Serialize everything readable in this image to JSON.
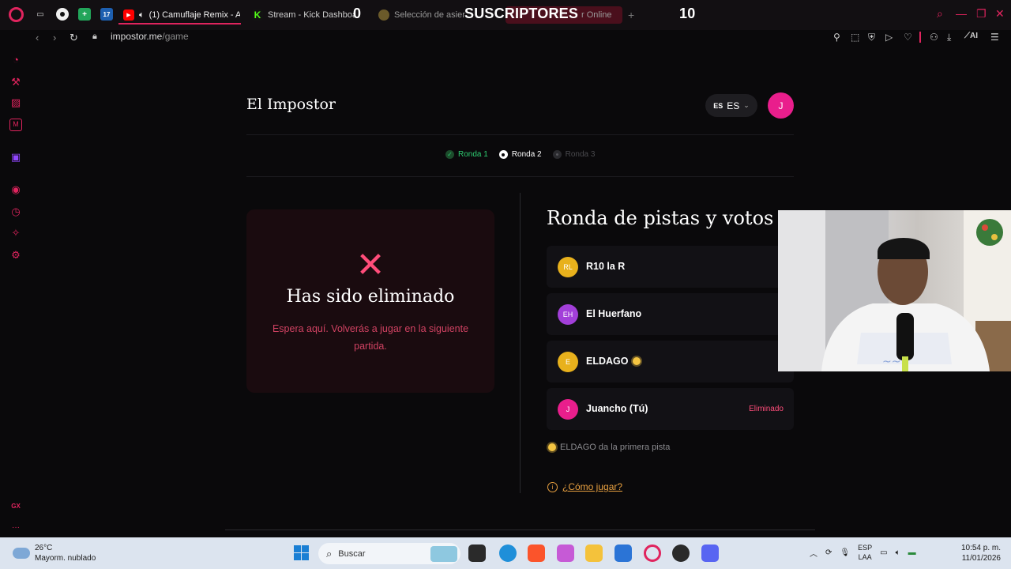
{
  "browser": {
    "tabs": [
      {
        "label": "(1) Camuflaje Remix - A",
        "icon": "youtube-icon"
      },
      {
        "label": "Stream - Kick Dashboar",
        "icon": "kick-icon"
      },
      {
        "label": "Selección de asient",
        "icon": "seat-icon"
      },
      {
        "label": "r Online",
        "icon": "game-icon"
      }
    ],
    "new_tab": "+",
    "url_host": "impostor.me",
    "url_path": "/game",
    "tools": [
      "pin-icon",
      "snapshot-icon",
      "shield-icon",
      "play-icon",
      "heart-icon",
      "profile-icon",
      "download-icon",
      "AI",
      "menu-icon"
    ],
    "ai_label": "AI"
  },
  "stream_overlay": {
    "subscribers_count": "0",
    "subscribers_label": "SUSCRIPTORES",
    "subscribers_goal": "10"
  },
  "sidebar": {
    "items": [
      "speed-dial-icon",
      "briefcase-icon",
      "gx-corner-icon",
      "messenger-icon",
      "twitch-icon",
      "player-icon",
      "history-icon",
      "extensions-icon",
      "settings-icon"
    ],
    "footer_label": "GX",
    "more": "···"
  },
  "header": {
    "title": "El Impostor",
    "lang_flag": "ES",
    "lang_code": "ES",
    "avatar_initial": "J"
  },
  "rounds": [
    {
      "label": "Ronda 1",
      "state": "done"
    },
    {
      "label": "Ronda 2",
      "state": "active"
    },
    {
      "label": "Ronda 3",
      "state": "pending"
    }
  ],
  "eliminated": {
    "icon": "✕",
    "title": "Has sido eliminado",
    "message": "Espera aquí. Volverás a jugar en la siguiente partida."
  },
  "voting": {
    "title": "Ronda de pistas y votos",
    "players": [
      {
        "initials": "RL",
        "name": "R10 la R",
        "color": "#e8b11c",
        "status": "",
        "first_clue": false
      },
      {
        "initials": "EH",
        "name": "El Huerfano",
        "color": "#a23fd9",
        "status": "",
        "first_clue": false
      },
      {
        "initials": "E",
        "name": "ELDAGO",
        "color": "#e8b11c",
        "status": "",
        "first_clue": true
      },
      {
        "initials": "J",
        "name": "Juancho (Tú)",
        "color": "#e91e8c",
        "status": "Eliminado",
        "first_clue": false
      }
    ],
    "first_clue_text": "ELDAGO da la primera pista",
    "how_to_play": "¿Cómo jugar?"
  },
  "taskbar": {
    "weather_temp": "26°C",
    "weather_desc": "Mayorm. nublado",
    "search_placeholder": "Buscar",
    "lang_top": "ESP",
    "lang_bottom": "LAA",
    "time": "10:54 p. m.",
    "date": "11/01/2026"
  },
  "colors": {
    "accent": "#e0245e",
    "eliminated": "#ff4d7a",
    "round_done": "#2ecc71",
    "link": "#e8a040"
  }
}
